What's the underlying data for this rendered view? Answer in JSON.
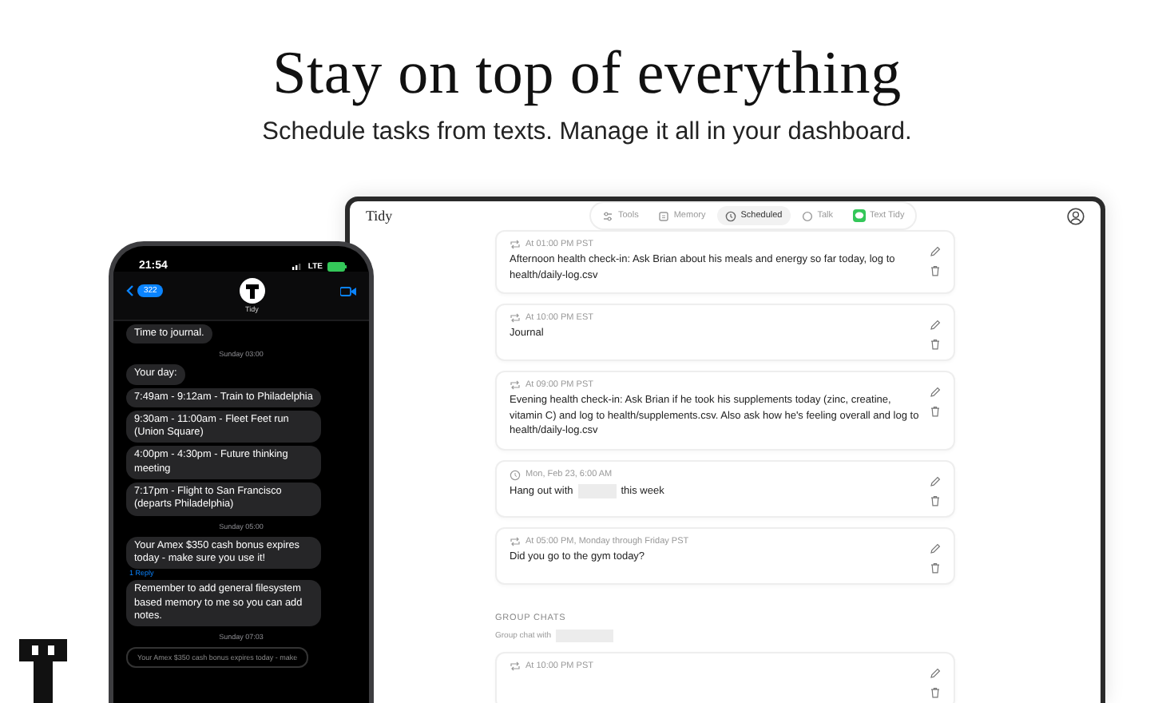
{
  "headline": "Stay on top of everything",
  "subheadline": "Schedule tasks from texts. Manage it all in your dashboard.",
  "phone": {
    "time": "21:54",
    "network": "LTE",
    "back_count": "322",
    "contact": "Tidy",
    "messages": [
      {
        "kind": "bubble",
        "text": "Time to journal."
      },
      {
        "kind": "timestamp",
        "text": "Sunday 03:00"
      },
      {
        "kind": "bubble",
        "text": "Your day:"
      },
      {
        "kind": "bubble",
        "text": "7:49am - 9:12am - Train to Philadelphia"
      },
      {
        "kind": "bubble",
        "text": "9:30am - 11:00am - Fleet Feet run (Union Square)"
      },
      {
        "kind": "bubble",
        "text": "4:00pm - 4:30pm - Future thinking meeting"
      },
      {
        "kind": "bubble",
        "text": "7:17pm - Flight to San Francisco (departs Philadelphia)"
      },
      {
        "kind": "timestamp",
        "text": "Sunday 05:00"
      },
      {
        "kind": "bubble",
        "text": "Your Amex $350 cash bonus expires today - make sure you use it!"
      },
      {
        "kind": "reply",
        "text": "1 Reply"
      },
      {
        "kind": "bubble",
        "text": "Remember to add general filesystem based memory to me so you can add notes."
      },
      {
        "kind": "timestamp",
        "text": "Sunday 07:03"
      },
      {
        "kind": "quote",
        "text": "Your Amex $350 cash bonus expires today - make"
      }
    ]
  },
  "dashboard": {
    "title": "Tidy",
    "tabs": [
      {
        "label": "Tools",
        "selected": false
      },
      {
        "label": "Memory",
        "selected": false
      },
      {
        "label": "Scheduled",
        "selected": true
      },
      {
        "label": "Talk",
        "selected": false
      },
      {
        "label": "Text Tidy",
        "selected": false
      }
    ],
    "cards": [
      {
        "kind": "recurring",
        "when": "At 01:00 PM PST",
        "segments": [
          {
            "kind": "text",
            "text": "Afternoon health check-in: Ask Brian about his meals and energy so far today, log to health/daily-log.csv"
          }
        ]
      },
      {
        "kind": "recurring",
        "when": "At 10:00 PM EST",
        "segments": [
          {
            "kind": "text",
            "text": "Journal"
          }
        ]
      },
      {
        "kind": "recurring",
        "when": "At 09:00 PM PST",
        "segments": [
          {
            "kind": "text",
            "text": "Evening health check-in: Ask Brian if he took his supplements today (zinc, creatine, vitamin C) and log to health/supplements.csv. Also ask how he's feeling overall and log to health/daily-log.csv"
          }
        ]
      },
      {
        "kind": "one_time",
        "when": "Mon, Feb 23, 6:00 AM",
        "segments": [
          {
            "kind": "text",
            "text": "Hang out with"
          },
          {
            "kind": "redacted"
          },
          {
            "kind": "text",
            "text": "this week"
          }
        ]
      },
      {
        "kind": "recurring",
        "when": "At 05:00 PM, Monday through Friday PST",
        "segments": [
          {
            "kind": "text",
            "text": "Did you go to the gym today?"
          }
        ]
      }
    ],
    "group_chats": {
      "title": "GROUP CHATS",
      "label_segments": [
        {
          "kind": "text",
          "text": "Group chat with"
        },
        {
          "kind": "redacted"
        }
      ],
      "cards": [
        {
          "kind": "recurring",
          "when": "At 10:00 PM PST"
        }
      ]
    }
  }
}
